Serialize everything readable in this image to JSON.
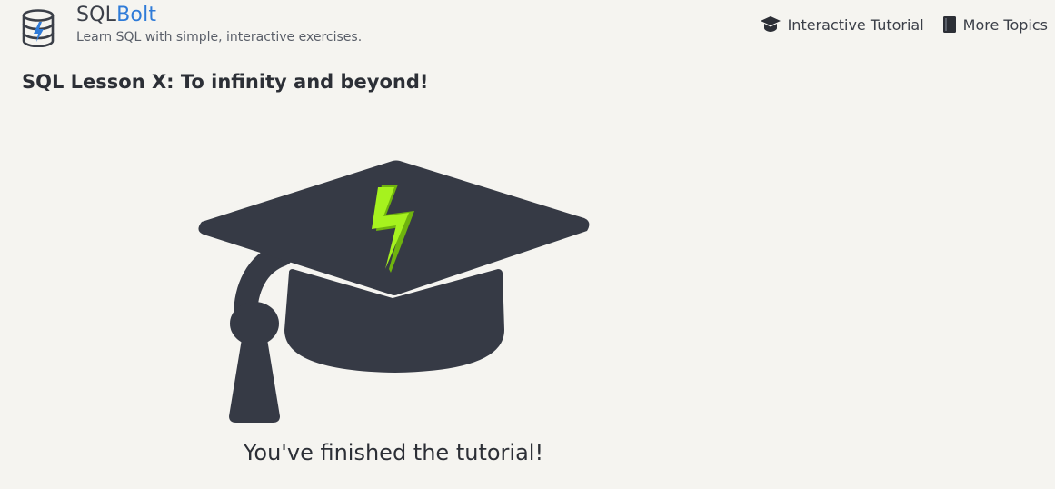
{
  "brand": {
    "name_part1": "SQL",
    "name_part2": "Bolt",
    "tagline": "Learn SQL with simple, interactive exercises.",
    "accent_color": "#2f7bd8",
    "logo_icon": "database-bolt-icon"
  },
  "nav": {
    "items": [
      {
        "label": "Interactive Tutorial",
        "icon": "graduation-cap-icon"
      },
      {
        "label": "More Topics",
        "icon": "book-icon"
      }
    ]
  },
  "lesson": {
    "title": "SQL Lesson X: To infinity and beyond!",
    "illustration": "graduation-cap-bolt",
    "completion_message": "You've finished the tutorial!"
  },
  "colors": {
    "cap": "#363a45",
    "bolt_light": "#a6f21e",
    "bolt_dark": "#6fb30e",
    "background": "#f5f4f0"
  }
}
